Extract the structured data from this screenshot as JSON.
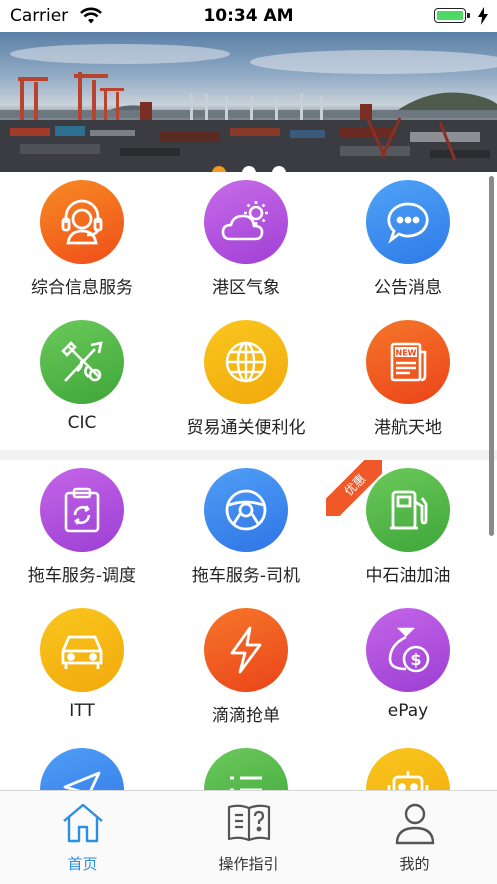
{
  "status_bar": {
    "carrier": "Carrier",
    "time": "10:34 AM"
  },
  "banner": {
    "page_count": 3,
    "active_page": 1
  },
  "section1": {
    "items": [
      {
        "label": "综合信息服务",
        "icon": "customer-service-icon",
        "color": "#f36a1e"
      },
      {
        "label": "港区气象",
        "icon": "weather-icon",
        "color": "#b252df"
      },
      {
        "label": "公告消息",
        "icon": "message-icon",
        "color": "#3b8df2"
      },
      {
        "label": "CIC",
        "icon": "cic-tools-icon",
        "color": "#56b847"
      },
      {
        "label": "贸易通关便利化",
        "icon": "globe-icon",
        "color": "#f5b50f"
      },
      {
        "label": "港航天地",
        "icon": "newspaper-icon",
        "color": "#f05a22"
      }
    ]
  },
  "section2": {
    "promo_badge": "优惠",
    "items": [
      {
        "label": "拖车服务-调度",
        "icon": "dispatch-clipboard-icon",
        "color": "#b04fd8"
      },
      {
        "label": "拖车服务-司机",
        "icon": "steering-wheel-icon",
        "color": "#3b86ee"
      },
      {
        "label": "中石油加油",
        "icon": "fuel-pump-icon",
        "color": "#56b847"
      },
      {
        "label": "ITT",
        "icon": "car-icon",
        "color": "#f5b50f"
      },
      {
        "label": "滴滴抢单",
        "icon": "lightning-icon",
        "color": "#f05a22"
      },
      {
        "label": "ePay",
        "icon": "money-bag-icon",
        "color": "#b452dd"
      },
      {
        "label": "",
        "icon": "send-icon",
        "color": "#3b86ee"
      },
      {
        "label": "",
        "icon": "list-icon",
        "color": "#56b847"
      },
      {
        "label": "",
        "icon": "robot-icon",
        "color": "#f5b50f"
      }
    ]
  },
  "tab_bar": {
    "tabs": [
      {
        "label": "首页",
        "icon": "home-icon",
        "active": true
      },
      {
        "label": "操作指引",
        "icon": "guide-book-icon",
        "active": false
      },
      {
        "label": "我的",
        "icon": "user-icon",
        "active": false
      }
    ]
  }
}
